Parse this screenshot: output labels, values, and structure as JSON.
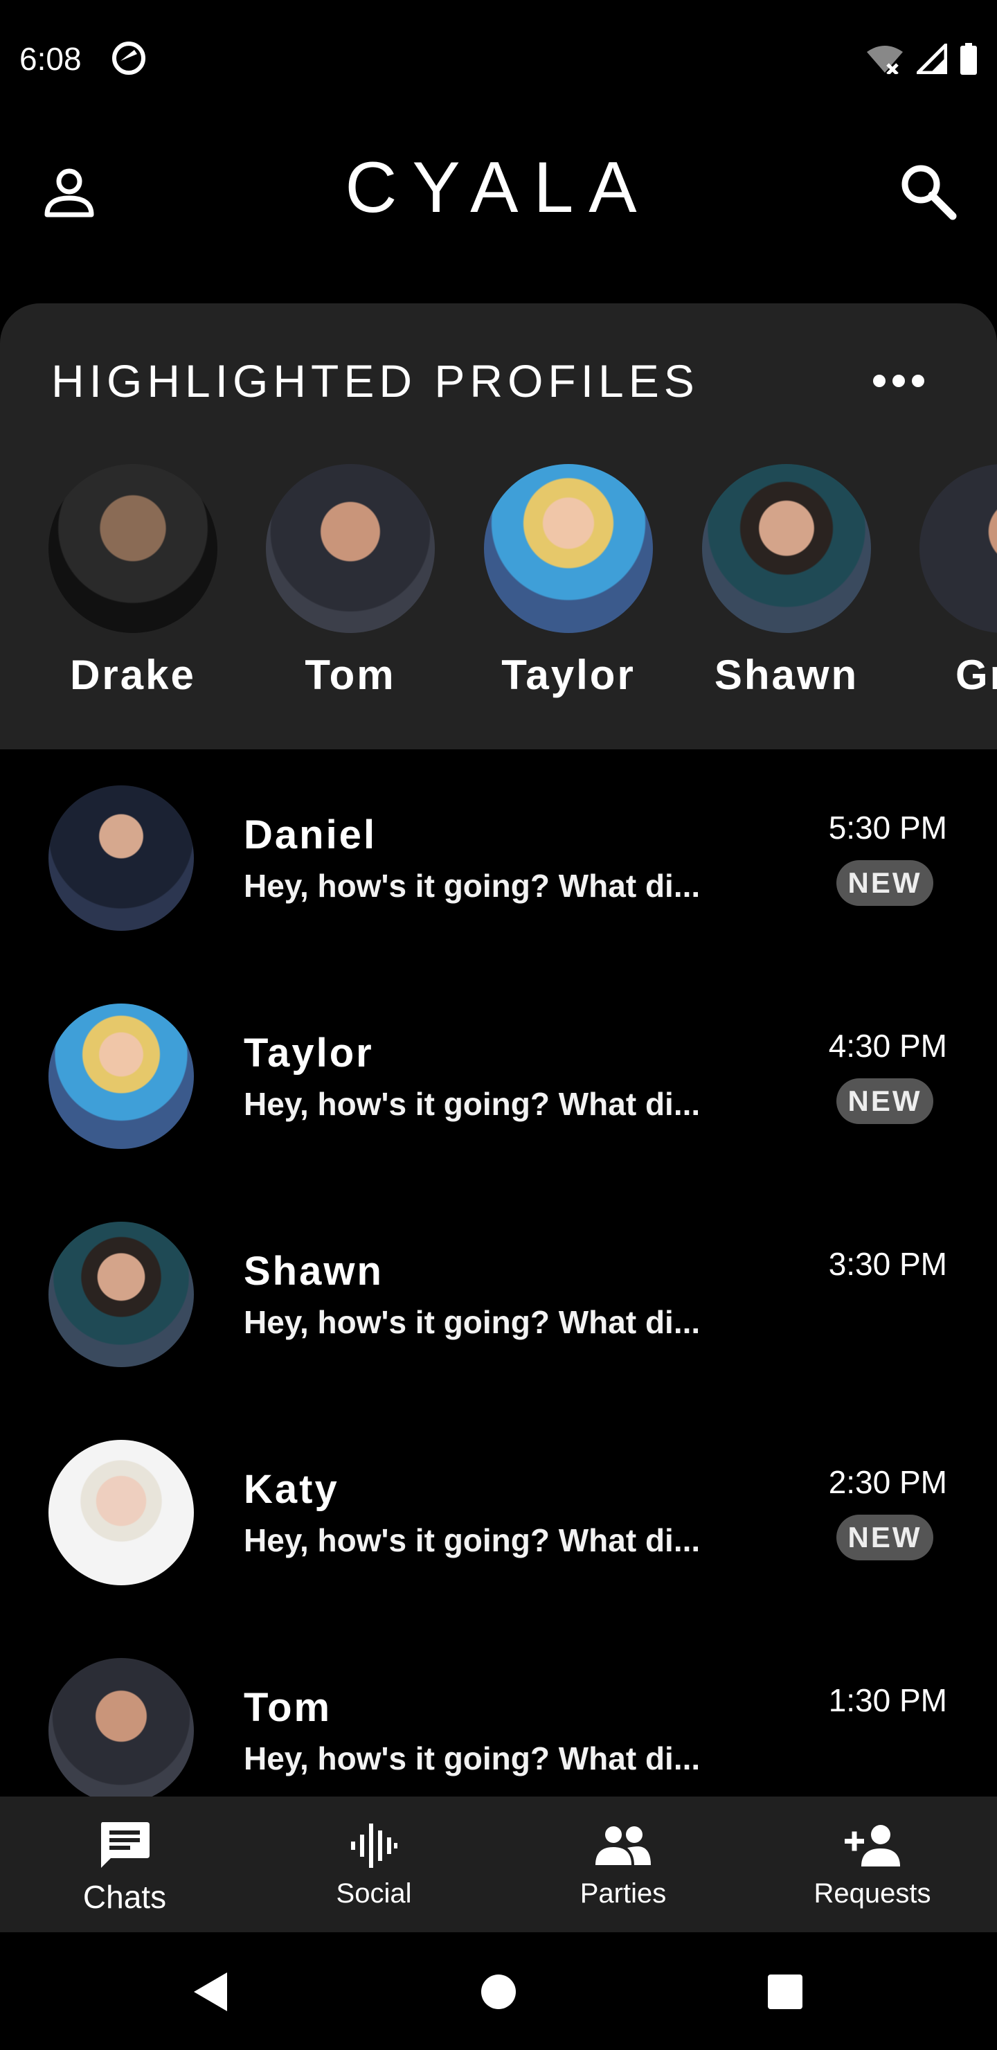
{
  "status_bar": {
    "time": "6:08"
  },
  "app_bar": {
    "title": "CYALA"
  },
  "highlights": {
    "title": "HIGHLIGHTED PROFILES",
    "profiles": [
      {
        "name": "Drake"
      },
      {
        "name": "Tom"
      },
      {
        "name": "Taylor"
      },
      {
        "name": "Shawn"
      },
      {
        "name": "Gr"
      }
    ]
  },
  "chats": [
    {
      "name": "Daniel",
      "message": "Hey, how's it going? What di...",
      "time": "5:30 PM",
      "badge": "NEW"
    },
    {
      "name": "Taylor",
      "message": "Hey, how's it going? What di...",
      "time": "4:30 PM",
      "badge": "NEW"
    },
    {
      "name": "Shawn",
      "message": "Hey, how's it going? What di...",
      "time": "3:30 PM",
      "badge": ""
    },
    {
      "name": "Katy",
      "message": "Hey, how's it going? What di...",
      "time": "2:30 PM",
      "badge": "NEW"
    },
    {
      "name": "Tom",
      "message": "Hey, how's it going? What di...",
      "time": "1:30 PM",
      "badge": ""
    }
  ],
  "bottom_nav": {
    "items": [
      {
        "label": "Chats",
        "icon": "chat-bubble-icon",
        "active": true
      },
      {
        "label": "Social",
        "icon": "audio-wave-icon",
        "active": false
      },
      {
        "label": "Parties",
        "icon": "group-icon",
        "active": false
      },
      {
        "label": "Requests",
        "icon": "person-add-icon",
        "active": false
      }
    ]
  },
  "colors": {
    "background": "#000000",
    "panel": "#232323",
    "badge": "#555555",
    "nav_bar": "#202020"
  }
}
